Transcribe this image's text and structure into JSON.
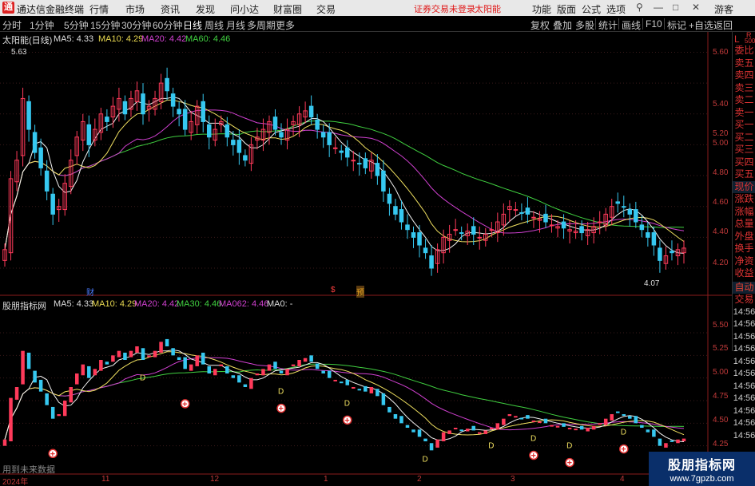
{
  "titlebar": {
    "logo": "通",
    "app_name": "通达信金融终端",
    "menus": [
      "行情",
      "市场",
      "资讯",
      "发现",
      "问小达",
      "财富圈",
      "交易"
    ],
    "warning": "证券交易未登录",
    "stock_name": "太阳能",
    "right_menus": [
      "功能",
      "版面",
      "公式",
      "选项"
    ],
    "win_buttons": [
      "⚲",
      "—",
      "□",
      "✕"
    ],
    "guest": "游客"
  },
  "toolbar": {
    "periods": [
      "分时",
      "1分钟",
      "5分钟",
      "15分钟",
      "30分钟",
      "60分钟",
      "日线",
      "周线",
      "月线",
      "多周期",
      "更多"
    ],
    "active_period": "日线",
    "tools": [
      "复权",
      "叠加",
      "多股",
      "统计",
      "画线",
      "F10",
      "标记",
      "+自选",
      "返回"
    ]
  },
  "upper_info": {
    "title": "太阳能(日线)",
    "ma5": "MA5: 4.33",
    "ma10": "MA10: 4.29",
    "ma20": "MA20: 4.42",
    "ma60": "MA60: 4.46"
  },
  "lower_info": {
    "title": "股朋指标网",
    "ma5": "MA5: 4.33",
    "ma10": "MA10: 4.29",
    "ma20": "MA20: 4.42",
    "ma30": "MA30: 4.46",
    "ma062": "MA062: 4.46",
    "ma0": "MA0: -"
  },
  "upper_axis": [
    "5.60",
    "5.40",
    "5.20",
    "5.00",
    "4.80",
    "4.60",
    "4.40",
    "4.20"
  ],
  "lower_axis": [
    "5.50",
    "5.25",
    "5.00",
    "4.75",
    "4.50",
    "4.25"
  ],
  "high_label": "5.63",
  "low_label": "4.07",
  "event_marks": [
    "财",
    "$",
    "预"
  ],
  "signal_d": "D",
  "signal_plus": "+",
  "footer_text": "用到未来数据",
  "date_labels": [
    "2024年",
    "11",
    "12",
    "1",
    "2",
    "3",
    "4"
  ],
  "side_corner": [
    "L",
    "R",
    "500"
  ],
  "side_items": [
    "委比",
    "卖五",
    "卖四",
    "卖三",
    "卖二",
    "卖一",
    "买一",
    "买二",
    "买三",
    "买四",
    "买五",
    "现价",
    "涨跌",
    "涨幅",
    "总量",
    "外盘",
    "换手",
    "净资",
    "收益"
  ],
  "side_lower": [
    "自动",
    "交易"
  ],
  "side_lower_times": [
    "14:56",
    "14:56",
    "14:56",
    "14:56",
    "14:56",
    "14:56",
    "14:56",
    "14:56",
    "14:56",
    "14:56",
    "14:56"
  ],
  "brand": {
    "name": "股朋指标网",
    "url": "www.7gpzb.com"
  },
  "colors": {
    "up": "#ff3a5a",
    "down": "#36c8f0",
    "ma5": "#f0f0f0",
    "ma10": "#f0e060",
    "ma20": "#d040d0",
    "ma60": "#40d040"
  },
  "chart_data": {
    "type": "candlestick",
    "title": "太阳能(日线)",
    "ylim": [
      4.05,
      5.68
    ],
    "high": 5.63,
    "low": 4.07,
    "closes": [
      4.32,
      4.78,
      4.9,
      5.3,
      5.1,
      4.95,
      4.85,
      4.7,
      4.55,
      4.6,
      4.75,
      4.9,
      5.05,
      5.15,
      5.0,
      5.1,
      5.2,
      5.15,
      5.25,
      5.3,
      5.2,
      5.3,
      5.35,
      5.2,
      5.25,
      5.3,
      5.4,
      5.35,
      5.25,
      5.2,
      5.1,
      5.15,
      5.25,
      5.15,
      5.05,
      5.1,
      5.15,
      5.05,
      5.0,
      4.95,
      4.9,
      5.0,
      5.05,
      5.1,
      5.15,
      5.1,
      5.05,
      5.1,
      5.15,
      5.2,
      5.22,
      5.18,
      5.1,
      5.05,
      5.0,
      4.98,
      4.95,
      4.92,
      4.9,
      4.88,
      4.85,
      4.9,
      4.8,
      4.7,
      4.62,
      4.55,
      4.5,
      4.45,
      4.4,
      4.35,
      4.3,
      4.2,
      4.32,
      4.4,
      4.42,
      4.45,
      4.43,
      4.44,
      4.42,
      4.4,
      4.42,
      4.45,
      4.5,
      4.55,
      4.6,
      4.58,
      4.56,
      4.55,
      4.53,
      4.52,
      4.5,
      4.48,
      4.47,
      4.46,
      4.45,
      4.44,
      4.43,
      4.45,
      4.47,
      4.5,
      4.55,
      4.6,
      4.62,
      4.6,
      4.55,
      4.5,
      4.45,
      4.4,
      4.35,
      4.25,
      4.28,
      4.3,
      4.32,
      4.33
    ]
  }
}
